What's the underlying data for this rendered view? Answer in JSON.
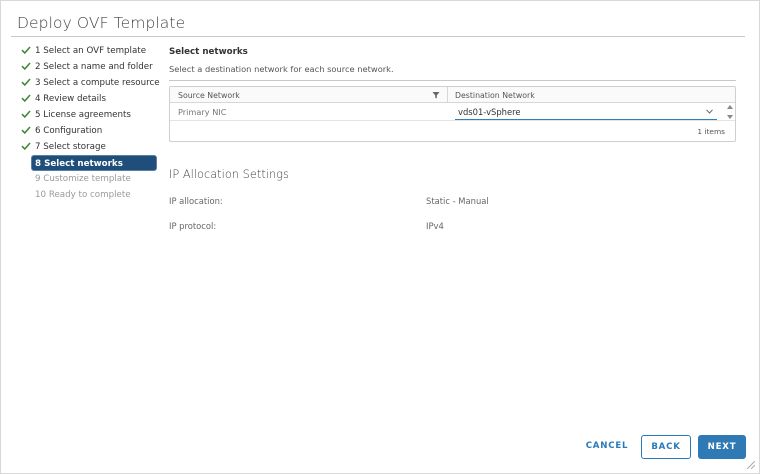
{
  "window": {
    "title": "Deploy OVF Template"
  },
  "steps": [
    {
      "label": "1 Select an OVF template",
      "state": "done"
    },
    {
      "label": "2 Select a name and folder",
      "state": "done"
    },
    {
      "label": "3 Select a compute resource",
      "state": "done"
    },
    {
      "label": "4 Review details",
      "state": "done"
    },
    {
      "label": "5 License agreements",
      "state": "done"
    },
    {
      "label": "6 Configuration",
      "state": "done"
    },
    {
      "label": "7 Select storage",
      "state": "done"
    },
    {
      "label": "8 Select networks",
      "state": "active"
    },
    {
      "label": "9 Customize template",
      "state": "pending"
    },
    {
      "label": "10 Ready to complete",
      "state": "pending"
    }
  ],
  "networks": {
    "title": "Select networks",
    "description": "Select a destination network for each source network.",
    "columns": {
      "source": "Source Network",
      "destination": "Destination Network"
    },
    "rows": [
      {
        "source": "Primary NIC",
        "destination": "vds01-vSphere"
      }
    ],
    "item_count": "1 items"
  },
  "ip_settings": {
    "title": "IP Allocation Settings",
    "allocation_label": "IP allocation:",
    "allocation_value": "Static - Manual",
    "protocol_label": "IP protocol:",
    "protocol_value": "IPv4"
  },
  "buttons": {
    "cancel": "CANCEL",
    "back": "BACK",
    "next": "NEXT"
  },
  "colors": {
    "check": "#3c8a3c",
    "active_step": "#1f4e7a",
    "primary": "#2f79b5",
    "link": "#2a7ab9"
  }
}
